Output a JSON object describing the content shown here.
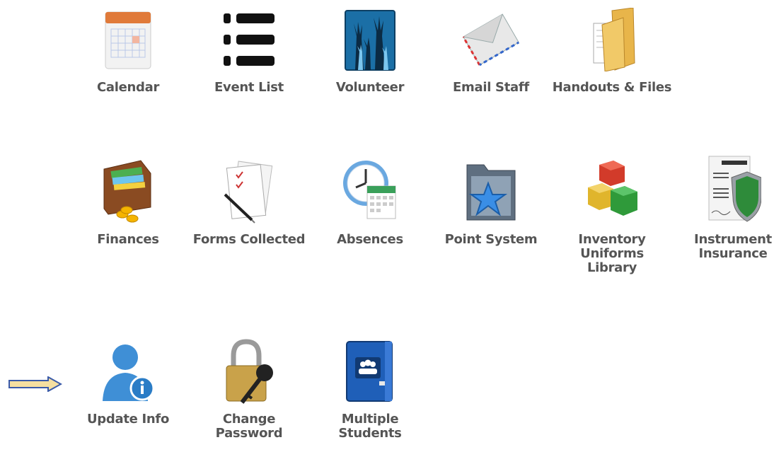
{
  "tiles": [
    {
      "label": "Calendar",
      "icon": "calendar-icon"
    },
    {
      "label": "Event List",
      "icon": "list-icon"
    },
    {
      "label": "Volunteer",
      "icon": "raised-hands-icon"
    },
    {
      "label": "Email Staff",
      "icon": "envelope-icon"
    },
    {
      "label": "Handouts & Files",
      "icon": "folder-icon"
    },
    {
      "label": "Finances",
      "icon": "wallet-icon"
    },
    {
      "label": "Forms Collected",
      "icon": "checklist-icon"
    },
    {
      "label": "Absences",
      "icon": "clock-calendar-icon"
    },
    {
      "label": "Point System",
      "icon": "star-folder-icon"
    },
    {
      "label": "Inventory\nUniforms\nLibrary",
      "icon": "boxes-icon"
    },
    {
      "label": "Instrument\nInsurance",
      "icon": "insurance-shield-icon"
    },
    {
      "label": "Update Info",
      "icon": "user-info-icon"
    },
    {
      "label": "Change\nPassword",
      "icon": "padlock-key-icon"
    },
    {
      "label": "Multiple\nStudents",
      "icon": "group-book-icon"
    }
  ],
  "colors": {
    "label": "#555555",
    "arrow_fill": "#f5dfa0",
    "arrow_stroke": "#3a5aa8"
  }
}
